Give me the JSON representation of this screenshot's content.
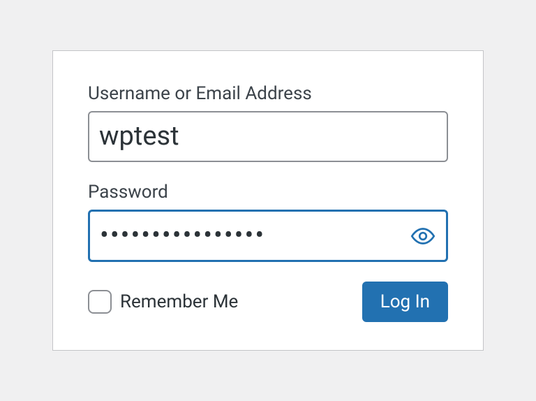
{
  "login": {
    "username_label": "Username or Email Address",
    "username_value": "wptest",
    "password_label": "Password",
    "password_value": "••••••••••••••••",
    "remember_label": "Remember Me",
    "remember_checked": false,
    "submit_label": "Log In"
  },
  "colors": {
    "focus_border": "#2271b1",
    "button_bg": "#2271b1",
    "page_bg": "#f0f0f1",
    "card_bg": "#ffffff",
    "text": "#2c3338",
    "label": "#3c434a"
  }
}
